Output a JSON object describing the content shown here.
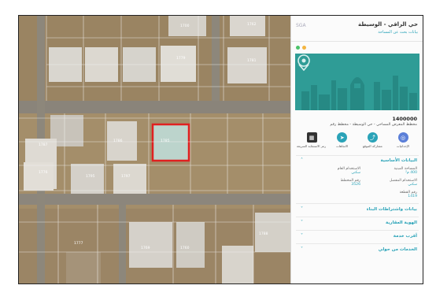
{
  "panel": {
    "title": "حي الراقي - الوسيطة",
    "subtitle": "بيانات بحث عن المساحة",
    "logo": "SGA",
    "parcel_id": "1400000",
    "parcel_desc": "مخطط المعرض المساحي - حي الوسيطة - مخطط رقم",
    "actions": [
      {
        "label": "الإحداثيات",
        "icon": "location-pin-icon",
        "color": "#5b7fd8"
      },
      {
        "label": "مشاركة الموقع",
        "icon": "share-icon",
        "color": "#2aa3b8"
      },
      {
        "label": "الاتجاهات",
        "icon": "directions-icon",
        "color": "#2aa3b8"
      },
      {
        "label": "رمز الاستجابة السريعة",
        "icon": "qr-code-icon",
        "color": "#333333"
      }
    ],
    "basic_info_title": "البيانات الأساسية",
    "basic_info": [
      {
        "key": "المساحة المبنية",
        "value": "400 م²"
      },
      {
        "key": "الاستخدام العام",
        "value": "سكني"
      },
      {
        "key": "الاستخدام المفصل",
        "value": "سكني"
      },
      {
        "key": "رقم المخطط",
        "value": "3526"
      },
      {
        "key": "رقم القطعة",
        "value": "1419"
      }
    ],
    "sections": [
      "بيانات واشتراطات البناء",
      "الهوية العقارية",
      "أقرب خدمة",
      "الخدمات من حولي"
    ]
  },
  "map": {
    "selected_parcel_label": "1785",
    "parcel_labels": [
      "1700",
      "1762",
      "1779",
      "1781",
      "1785",
      "1786",
      "1787",
      "1795",
      "1797",
      "1776",
      "1769",
      "1760",
      "1777",
      "1788"
    ],
    "highlight_color": "#e02020"
  }
}
